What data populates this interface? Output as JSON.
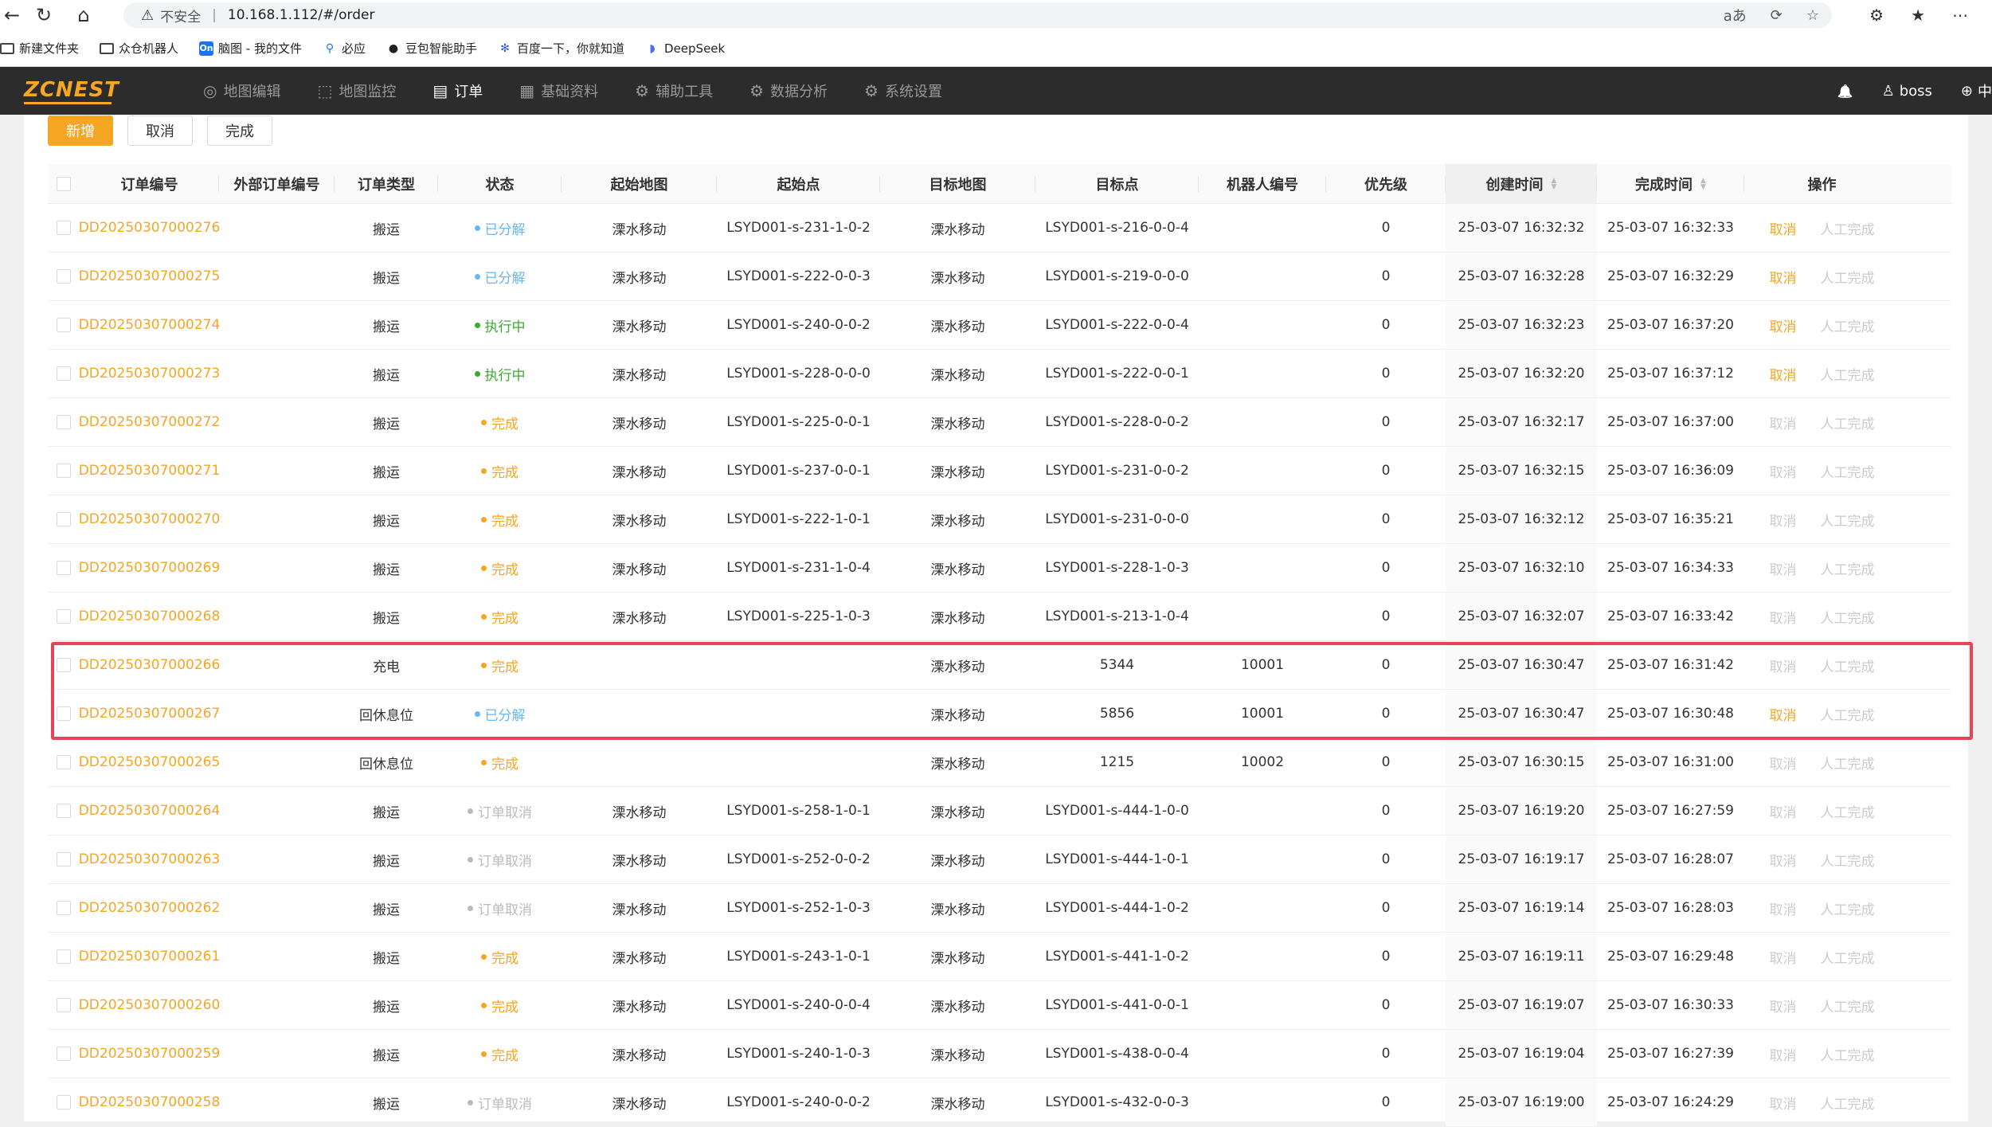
{
  "browser": {
    "back": "←",
    "reload": "↻",
    "home": "⌂",
    "warn_icon": "⚠",
    "insecure": "不安全",
    "sep": "|",
    "url": "10.168.1.112/#/order",
    "right_icons": [
      "aあ",
      "⟳",
      "☆"
    ],
    "toolbar_icons": [
      "⚙",
      "★",
      "⋯"
    ]
  },
  "bookmarks": [
    {
      "icon": "folder",
      "label": "新建文件夹"
    },
    {
      "icon": "folder",
      "label": "众仓机器人"
    },
    {
      "icon": "on",
      "label": "脑图 - 我的文件"
    },
    {
      "icon": "search",
      "label": "必应"
    },
    {
      "icon": "doubao",
      "label": "豆包智能助手"
    },
    {
      "icon": "baidu",
      "label": "百度一下，你就知道"
    },
    {
      "icon": "deepseek",
      "label": "DeepSeek"
    }
  ],
  "app": {
    "logo": "ZCNEST",
    "menu": [
      {
        "icon": "◎",
        "label": "地图编辑",
        "active": false
      },
      {
        "icon": "⬚",
        "label": "地图监控",
        "active": false
      },
      {
        "icon": "▤",
        "label": "订单",
        "active": true
      },
      {
        "icon": "▦",
        "label": "基础资料",
        "active": false
      },
      {
        "icon": "⚙",
        "label": "辅助工具",
        "active": false
      },
      {
        "icon": "⚙",
        "label": "数据分析",
        "active": false
      },
      {
        "icon": "⚙",
        "label": "系统设置",
        "active": false
      }
    ],
    "bell": "🔔",
    "user_icon": "♙",
    "user": "boss",
    "lang_icon": "⊕",
    "lang": "中"
  },
  "toolbar": {
    "add": "新增",
    "cancel": "取消",
    "complete": "完成"
  },
  "table": {
    "headers": [
      "订单编号",
      "外部订单编号",
      "订单类型",
      "状态",
      "起始地图",
      "起始点",
      "目标地图",
      "目标点",
      "机器人编号",
      "优先级",
      "创建时间",
      "完成时间",
      "操作"
    ],
    "action_cancel": "取消",
    "action_manual": "人工完成",
    "status_colors": {
      "已分解": "#69b7f0",
      "执行中": "#3bab2e",
      "完成": "#f5a623",
      "订单取消": "#bbbbbb"
    },
    "rows": [
      {
        "no": "DD20250307000276",
        "ext": "",
        "type": "搬运",
        "status": "已分解",
        "smap": "溧水移动",
        "spt": "LSYD001-s-231-1-0-2",
        "tmap": "溧水移动",
        "tpt": "LSYD001-s-216-0-0-4",
        "robot": "",
        "pri": "0",
        "created": "25-03-07 16:32:32",
        "done": "25-03-07 16:32:33",
        "cancel_active": true
      },
      {
        "no": "DD20250307000275",
        "ext": "",
        "type": "搬运",
        "status": "已分解",
        "smap": "溧水移动",
        "spt": "LSYD001-s-222-0-0-3",
        "tmap": "溧水移动",
        "tpt": "LSYD001-s-219-0-0-0",
        "robot": "",
        "pri": "0",
        "created": "25-03-07 16:32:28",
        "done": "25-03-07 16:32:29",
        "cancel_active": true
      },
      {
        "no": "DD20250307000274",
        "ext": "",
        "type": "搬运",
        "status": "执行中",
        "smap": "溧水移动",
        "spt": "LSYD001-s-240-0-0-2",
        "tmap": "溧水移动",
        "tpt": "LSYD001-s-222-0-0-4",
        "robot": "",
        "pri": "0",
        "created": "25-03-07 16:32:23",
        "done": "25-03-07 16:37:20",
        "cancel_active": true
      },
      {
        "no": "DD20250307000273",
        "ext": "",
        "type": "搬运",
        "status": "执行中",
        "smap": "溧水移动",
        "spt": "LSYD001-s-228-0-0-0",
        "tmap": "溧水移动",
        "tpt": "LSYD001-s-222-0-0-1",
        "robot": "",
        "pri": "0",
        "created": "25-03-07 16:32:20",
        "done": "25-03-07 16:37:12",
        "cancel_active": true
      },
      {
        "no": "DD20250307000272",
        "ext": "",
        "type": "搬运",
        "status": "完成",
        "smap": "溧水移动",
        "spt": "LSYD001-s-225-0-0-1",
        "tmap": "溧水移动",
        "tpt": "LSYD001-s-228-0-0-2",
        "robot": "",
        "pri": "0",
        "created": "25-03-07 16:32:17",
        "done": "25-03-07 16:37:00",
        "cancel_active": false
      },
      {
        "no": "DD20250307000271",
        "ext": "",
        "type": "搬运",
        "status": "完成",
        "smap": "溧水移动",
        "spt": "LSYD001-s-237-0-0-1",
        "tmap": "溧水移动",
        "tpt": "LSYD001-s-231-0-0-2",
        "robot": "",
        "pri": "0",
        "created": "25-03-07 16:32:15",
        "done": "25-03-07 16:36:09",
        "cancel_active": false
      },
      {
        "no": "DD20250307000270",
        "ext": "",
        "type": "搬运",
        "status": "完成",
        "smap": "溧水移动",
        "spt": "LSYD001-s-222-1-0-1",
        "tmap": "溧水移动",
        "tpt": "LSYD001-s-231-0-0-0",
        "robot": "",
        "pri": "0",
        "created": "25-03-07 16:32:12",
        "done": "25-03-07 16:35:21",
        "cancel_active": false
      },
      {
        "no": "DD20250307000269",
        "ext": "",
        "type": "搬运",
        "status": "完成",
        "smap": "溧水移动",
        "spt": "LSYD001-s-231-1-0-4",
        "tmap": "溧水移动",
        "tpt": "LSYD001-s-228-1-0-3",
        "robot": "",
        "pri": "0",
        "created": "25-03-07 16:32:10",
        "done": "25-03-07 16:34:33",
        "cancel_active": false
      },
      {
        "no": "DD20250307000268",
        "ext": "",
        "type": "搬运",
        "status": "完成",
        "smap": "溧水移动",
        "spt": "LSYD001-s-225-1-0-3",
        "tmap": "溧水移动",
        "tpt": "LSYD001-s-213-1-0-4",
        "robot": "",
        "pri": "0",
        "created": "25-03-07 16:32:07",
        "done": "25-03-07 16:33:42",
        "cancel_active": false
      },
      {
        "no": "DD20250307000266",
        "ext": "",
        "type": "充电",
        "status": "完成",
        "smap": "",
        "spt": "",
        "tmap": "溧水移动",
        "tpt": "5344",
        "robot": "10001",
        "pri": "0",
        "created": "25-03-07 16:30:47",
        "done": "25-03-07 16:31:42",
        "cancel_active": false
      },
      {
        "no": "DD20250307000267",
        "ext": "",
        "type": "回休息位",
        "status": "已分解",
        "smap": "",
        "spt": "",
        "tmap": "溧水移动",
        "tpt": "5856",
        "robot": "10001",
        "pri": "0",
        "created": "25-03-07 16:30:47",
        "done": "25-03-07 16:30:48",
        "cancel_active": true
      },
      {
        "no": "DD20250307000265",
        "ext": "",
        "type": "回休息位",
        "status": "完成",
        "smap": "",
        "spt": "",
        "tmap": "溧水移动",
        "tpt": "1215",
        "robot": "10002",
        "pri": "0",
        "created": "25-03-07 16:30:15",
        "done": "25-03-07 16:31:00",
        "cancel_active": false
      },
      {
        "no": "DD20250307000264",
        "ext": "",
        "type": "搬运",
        "status": "订单取消",
        "smap": "溧水移动",
        "spt": "LSYD001-s-258-1-0-1",
        "tmap": "溧水移动",
        "tpt": "LSYD001-s-444-1-0-0",
        "robot": "",
        "pri": "0",
        "created": "25-03-07 16:19:20",
        "done": "25-03-07 16:27:59",
        "cancel_active": false
      },
      {
        "no": "DD20250307000263",
        "ext": "",
        "type": "搬运",
        "status": "订单取消",
        "smap": "溧水移动",
        "spt": "LSYD001-s-252-0-0-2",
        "tmap": "溧水移动",
        "tpt": "LSYD001-s-444-1-0-1",
        "robot": "",
        "pri": "0",
        "created": "25-03-07 16:19:17",
        "done": "25-03-07 16:28:07",
        "cancel_active": false
      },
      {
        "no": "DD20250307000262",
        "ext": "",
        "type": "搬运",
        "status": "订单取消",
        "smap": "溧水移动",
        "spt": "LSYD001-s-252-1-0-3",
        "tmap": "溧水移动",
        "tpt": "LSYD001-s-444-1-0-2",
        "robot": "",
        "pri": "0",
        "created": "25-03-07 16:19:14",
        "done": "25-03-07 16:28:03",
        "cancel_active": false
      },
      {
        "no": "DD20250307000261",
        "ext": "",
        "type": "搬运",
        "status": "完成",
        "smap": "溧水移动",
        "spt": "LSYD001-s-243-1-0-1",
        "tmap": "溧水移动",
        "tpt": "LSYD001-s-441-1-0-2",
        "robot": "",
        "pri": "0",
        "created": "25-03-07 16:19:11",
        "done": "25-03-07 16:29:48",
        "cancel_active": false
      },
      {
        "no": "DD20250307000260",
        "ext": "",
        "type": "搬运",
        "status": "完成",
        "smap": "溧水移动",
        "spt": "LSYD001-s-240-0-0-4",
        "tmap": "溧水移动",
        "tpt": "LSYD001-s-441-0-0-1",
        "robot": "",
        "pri": "0",
        "created": "25-03-07 16:19:07",
        "done": "25-03-07 16:30:33",
        "cancel_active": false
      },
      {
        "no": "DD20250307000259",
        "ext": "",
        "type": "搬运",
        "status": "完成",
        "smap": "溧水移动",
        "spt": "LSYD001-s-240-1-0-3",
        "tmap": "溧水移动",
        "tpt": "LSYD001-s-438-0-0-4",
        "robot": "",
        "pri": "0",
        "created": "25-03-07 16:19:04",
        "done": "25-03-07 16:27:39",
        "cancel_active": false
      },
      {
        "no": "DD20250307000258",
        "ext": "",
        "type": "搬运",
        "status": "订单取消",
        "smap": "溧水移动",
        "spt": "LSYD001-s-240-0-0-2",
        "tmap": "溧水移动",
        "tpt": "LSYD001-s-432-0-0-3",
        "robot": "",
        "pri": "0",
        "created": "25-03-07 16:19:00",
        "done": "25-03-07 16:24:29",
        "cancel_active": false
      }
    ]
  }
}
